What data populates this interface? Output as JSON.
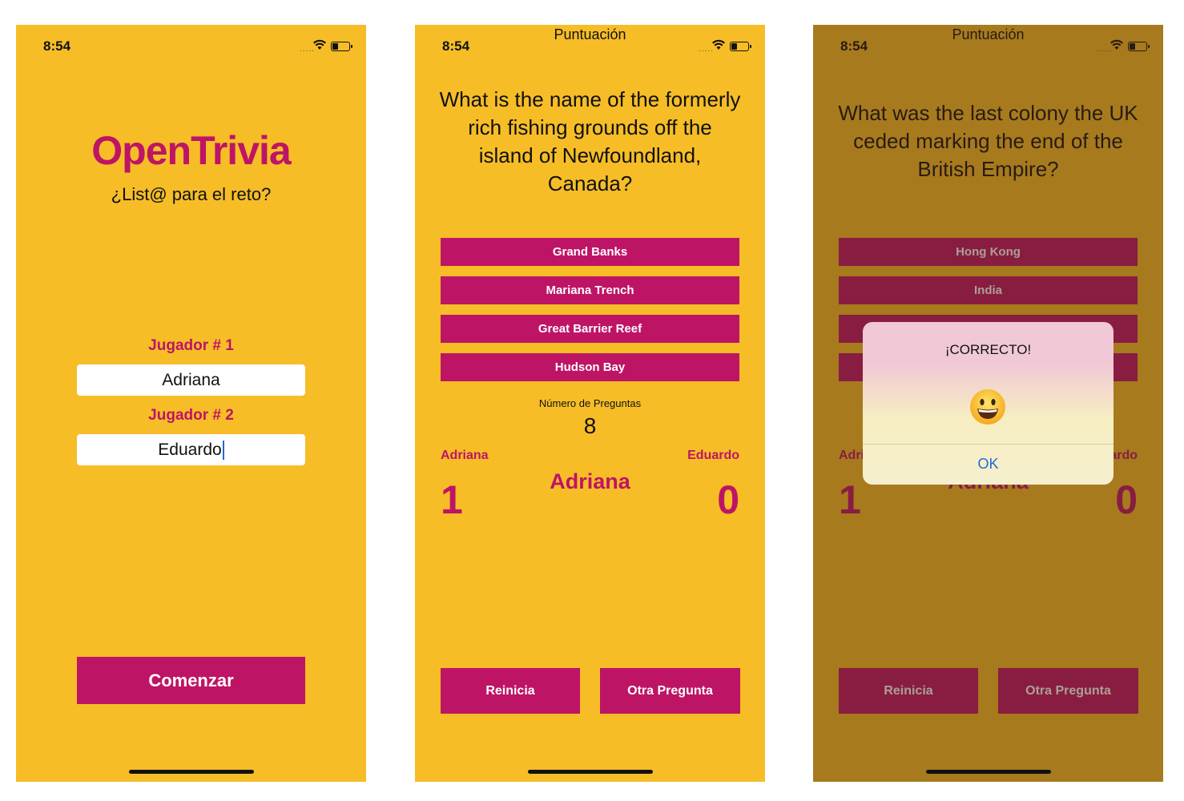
{
  "status_bar": {
    "time": "8:54",
    "signal": "....."
  },
  "screen1": {
    "app_title": "OpenTrivia",
    "subtitle": "¿List@ para el reto?",
    "player1_label": "Jugador # 1",
    "player1_value": "Adriana",
    "player2_label": "Jugador # 2",
    "player2_value": "Eduardo",
    "start_button": "Comenzar"
  },
  "screen2": {
    "nav_title": "Puntuación",
    "question": "What is the name of the formerly rich fishing grounds off the island of Newfoundland, Canada?",
    "answers": [
      "Grand Banks",
      "Mariana Trench",
      "Great Barrier Reef",
      "Hudson Bay"
    ],
    "num_questions_label": "Número de Preguntas",
    "num_questions_value": "8",
    "player1_name": "Adriana",
    "player2_name": "Eduardo",
    "current_player": "Adriana",
    "player1_score": "1",
    "player2_score": "0",
    "reset_button": "Reinicia",
    "next_button": "Otra Pregunta"
  },
  "screen3": {
    "nav_title": "Puntuación",
    "question": "What was the last colony the UK ceded marking the end of the British Empire?",
    "answers": [
      "Hong Kong",
      "India",
      "",
      ""
    ],
    "player1_name": "Adriana",
    "player2_name": "Eduardo",
    "current_player": "Adriana",
    "player1_score": "1",
    "player2_score": "0",
    "reset_button": "Reinicia",
    "next_button": "Otra Pregunta",
    "alert": {
      "title": "¡CORRECTO!",
      "emoji": "smiley-face-icon",
      "ok_label": "OK"
    }
  },
  "colors": {
    "background": "#f6bd27",
    "accent": "#be1466",
    "link": "#1b6bd8"
  }
}
